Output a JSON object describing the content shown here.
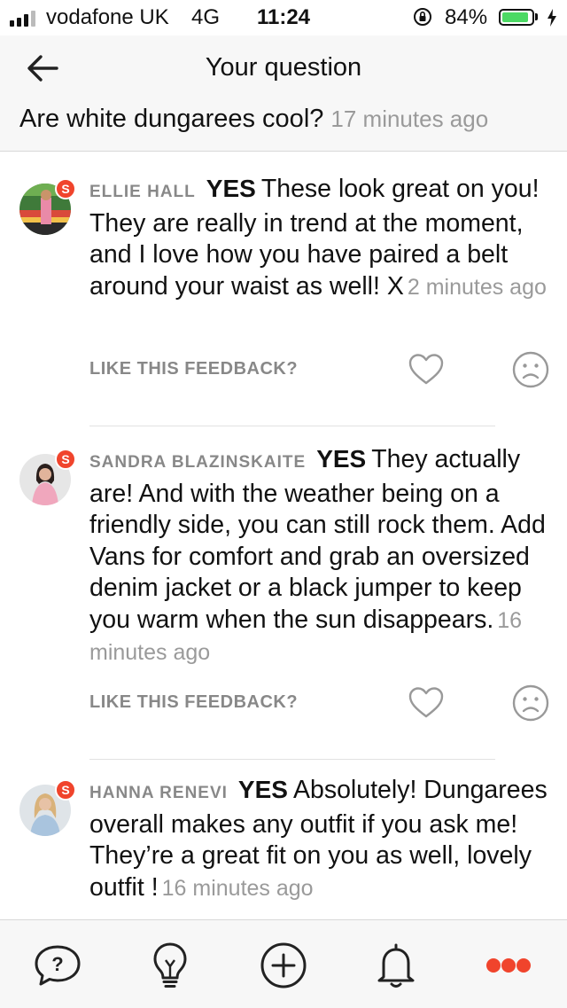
{
  "status_bar": {
    "carrier": "vodafone UK",
    "network": "4G",
    "time": "11:24",
    "battery_percent": "84%",
    "battery_level": 0.84,
    "battery_color": "#4cd964",
    "icons": [
      "signal-bars-icon",
      "rotation-lock-icon",
      "battery-icon",
      "charging-bolt-icon"
    ]
  },
  "header": {
    "back_icon": "arrow-left-icon",
    "title": "Your question",
    "question": "Are white dungarees cool?",
    "question_time": "17 minutes ago"
  },
  "feedback": [
    {
      "author": "ELLIE HALL",
      "verdict": "YES",
      "text": "These look great on you! They are really in trend at the moment, and I love how you have paired a belt around your waist as well! X",
      "time": "2 minutes ago",
      "badge": "S",
      "like_label": "LIKE THIS FEEDBACK?"
    },
    {
      "author": "SANDRA BLAZINSKAITE",
      "verdict": "YES",
      "text": "They actually are! And with the weather being on a friendly side, you can still rock them. Add Vans for comfort and grab an oversized denim jacket or a black jumper to keep you warm when the sun disappears.",
      "time": "16 minutes ago",
      "badge": "S",
      "like_label": "LIKE THIS FEEDBACK?"
    },
    {
      "author": "HANNA RENEVI",
      "verdict": "YES",
      "text": "Absolutely! Dungarees overall makes any outfit if you ask me! They’re a great fit on you as well, lovely outfit !",
      "time": "16 minutes ago",
      "badge": "S",
      "like_label": ""
    }
  ],
  "tab_bar": {
    "tabs": [
      "question-icon",
      "lightbulb-icon",
      "add-icon",
      "bell-icon",
      "more-icon"
    ],
    "accent_color": "#f0442c"
  }
}
